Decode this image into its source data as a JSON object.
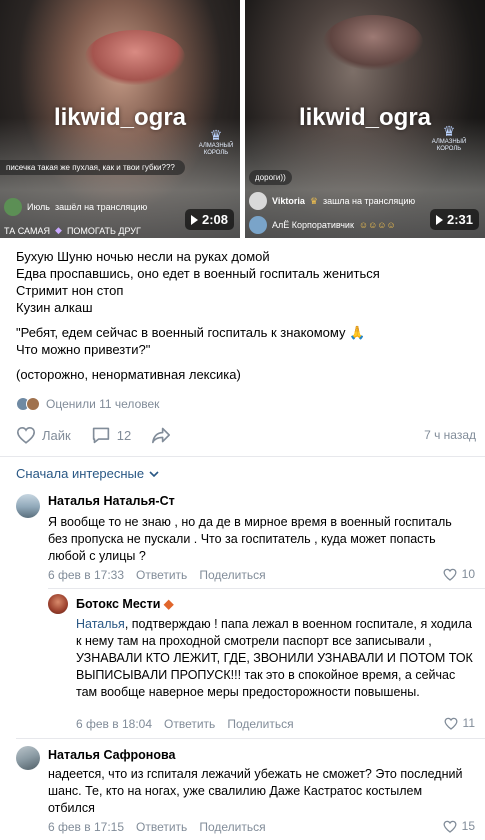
{
  "videos": [
    {
      "watermark": "likwid_ogra",
      "crown_label_1": "АЛМАЗНЫЙ",
      "crown_label_2": "КОРОЛЬ",
      "bubble_text": "писечка такая же пухлая, как и твои губки???",
      "chat1_user": "Июль",
      "chat1_action": "зашёл на трансляцию",
      "chat2_text": "ТА САМАЯ",
      "chat2_action": "ПОМОГАТЬ ДРУГ",
      "duration": "2:08"
    },
    {
      "watermark": "likwid_ogra",
      "crown_label_1": "АЛМАЗНЫЙ",
      "crown_label_2": "КОРОЛЬ",
      "bubble_text": "дороги))",
      "chat1_user": "Viktoria",
      "chat1_action": "зашла на трансляцию",
      "chat2_text": "АлЁ Корпоративчик",
      "chat2_action": "",
      "duration": "2:31"
    }
  ],
  "post": {
    "line1": "Бухую Шуню ночью несли на руках домой",
    "line2": "Едва проспавшись, оно едет в военный госпиталь жениться",
    "line3": "Стримит нон стоп",
    "line4": "Кузин алкаш",
    "line5": "\"Ребят, едем сейчас в военный госпиталь к знакомому 🙏",
    "line6": "Что можно привезти?\"",
    "line7": "(осторожно, ненормативная лексика)",
    "rated": "Оценили 11 человек",
    "like_label": "Лайк",
    "comments_count": "12",
    "time": "7 ч назад"
  },
  "sort_label": "Сначала интересные",
  "comments": [
    {
      "name": "Наталья Наталья-Ст",
      "text": "Я вообще то не знаю , но да де в мирное время в военный госпиталь без пропуска не пускали . Что за госпитатель , куда может попасть любой с улицы ?",
      "date": "6 фев в 17:33",
      "reply": "Ответить",
      "share": "Поделиться",
      "likes": "10"
    },
    {
      "name": "Ботокс Мести",
      "mention": "Наталья",
      "text": ", подтверждаю ! папа лежал в военном госпитале, я ходила к нему там на проходной смотрели паспорт все записывали , УЗНАВАЛИ КТО ЛЕЖИТ, ГДЕ, ЗВОНИЛИ УЗНАВАЛИ И ПОТОМ ТОК ВЫПИСЫВАЛИ ПРОПУСК!!! так это в спокойное время, а сейчас там вообще наверное меры предосторожности повышены.",
      "date": "6 фев в 18:04",
      "reply": "Ответить",
      "share": "Поделиться",
      "likes": "11"
    },
    {
      "name": "Наталья Сафронова",
      "text": "надеется, что из гспиталя лежачий убежать не сможет? Это последний шанс. Те, кто на ногах, уже свалилию Даже Кастратос костылем отбился",
      "date": "6 фев в 17:15",
      "reply": "Ответить",
      "share": "Поделиться",
      "likes": "15"
    }
  ],
  "colors": {
    "link": "#2a5885",
    "meta": "#818c99",
    "divider": "#e7e8ec"
  }
}
